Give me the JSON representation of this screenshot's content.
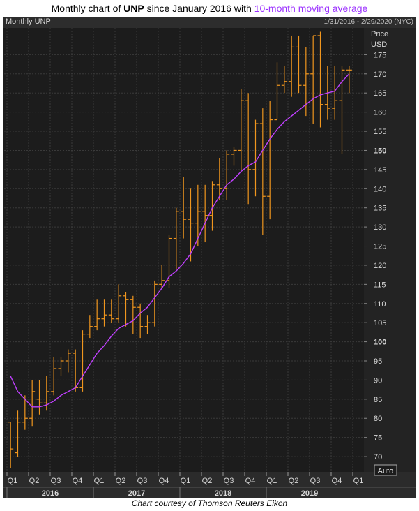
{
  "figure": {
    "title_prefix": "Monthly chart of ",
    "title_symbol": "UNP",
    "title_mid": " since January 2016 with ",
    "title_ma": "10-month moving average",
    "panel_label": "Monthly UNP",
    "date_range": "1/31/2016 - 2/29/2020 (NYC)",
    "price_label_1": "Price",
    "price_label_2": "USD",
    "auto_label": "Auto",
    "footer": "Chart courtesy of Thomson Reuters Eikon"
  },
  "colors": {
    "panel_bg": "#1c1c1c",
    "grid": "#3a3a3a",
    "bars": "#f0961e",
    "moving_average": "#c040ff",
    "axis_text": "#d8d8d8"
  },
  "chart_data": {
    "type": "ohlc",
    "title": "Monthly chart of UNP since January 2016 with 10-month moving average",
    "ylabel": "Price USD",
    "ylim": [
      66,
      182
    ],
    "y_ticks": [
      70,
      75,
      80,
      85,
      90,
      95,
      100,
      105,
      110,
      115,
      120,
      125,
      130,
      135,
      140,
      145,
      150,
      155,
      160,
      165,
      170,
      175
    ],
    "y_ticks_bold": [
      100,
      150
    ],
    "x_ticks": [
      "Q1",
      "Q2",
      "Q3",
      "Q4",
      "Q1",
      "Q2",
      "Q3",
      "Q4",
      "Q1",
      "Q2",
      "Q3",
      "Q4",
      "Q1",
      "Q2",
      "Q3",
      "Q4",
      "Q1"
    ],
    "years": [
      "2016",
      "2017",
      "2018",
      "2019"
    ],
    "grid": true,
    "months": [
      "2016-01",
      "2016-02",
      "2016-03",
      "2016-04",
      "2016-05",
      "2016-06",
      "2016-07",
      "2016-08",
      "2016-09",
      "2016-10",
      "2016-11",
      "2016-12",
      "2017-01",
      "2017-02",
      "2017-03",
      "2017-04",
      "2017-05",
      "2017-06",
      "2017-07",
      "2017-08",
      "2017-09",
      "2017-10",
      "2017-11",
      "2017-12",
      "2018-01",
      "2018-02",
      "2018-03",
      "2018-04",
      "2018-05",
      "2018-06",
      "2018-07",
      "2018-08",
      "2018-09",
      "2018-10",
      "2018-11",
      "2018-12",
      "2019-01",
      "2019-02",
      "2019-03",
      "2019-04",
      "2019-05",
      "2019-06",
      "2019-07",
      "2019-08",
      "2019-09",
      "2019-10",
      "2019-11",
      "2019-12"
    ],
    "series": [
      {
        "name": "UNP",
        "ohlc": [
          [
            79,
            79,
            67,
            72
          ],
          [
            71,
            82,
            70,
            79
          ],
          [
            79,
            86,
            77,
            80
          ],
          [
            80,
            90,
            78,
            87
          ],
          [
            85,
            90,
            81,
            84
          ],
          [
            84,
            91,
            82,
            87
          ],
          [
            87,
            96,
            86,
            93
          ],
          [
            93,
            96,
            91,
            95
          ],
          [
            95,
            98,
            92,
            97
          ],
          [
            97,
            98,
            87,
            88
          ],
          [
            88,
            103,
            87,
            102
          ],
          [
            102,
            107,
            101,
            104
          ],
          [
            104,
            111,
            103,
            106
          ],
          [
            106,
            111,
            104,
            107
          ],
          [
            107,
            111,
            105,
            106
          ],
          [
            106,
            115,
            105,
            112
          ],
          [
            112,
            113,
            104,
            111
          ],
          [
            111,
            112,
            102,
            109
          ],
          [
            109,
            110,
            101,
            104
          ],
          [
            104,
            107,
            102,
            105
          ],
          [
            105,
            116,
            104,
            115
          ],
          [
            115,
            120,
            114,
            116
          ],
          [
            116,
            128,
            114,
            127
          ],
          [
            127,
            135,
            119,
            134
          ],
          [
            134,
            143,
            127,
            132
          ],
          [
            132,
            140,
            121,
            131
          ],
          [
            131,
            141,
            125,
            134
          ],
          [
            134,
            141,
            126,
            133
          ],
          [
            133,
            142,
            129,
            141
          ],
          [
            141,
            148,
            137,
            140
          ],
          [
            140,
            150,
            137,
            149
          ],
          [
            149,
            151,
            146,
            150
          ],
          [
            150,
            166,
            145,
            163
          ],
          [
            163,
            165,
            136,
            145
          ],
          [
            145,
            158,
            138,
            157
          ],
          [
            157,
            161,
            128,
            138
          ],
          [
            138,
            163,
            132,
            158
          ],
          [
            158,
            173,
            158,
            167
          ],
          [
            167,
            172,
            165,
            168
          ],
          [
            168,
            180,
            164,
            177
          ],
          [
            177,
            180,
            165,
            167
          ],
          [
            167,
            177,
            159,
            170
          ],
          [
            170,
            180,
            157,
            180
          ],
          [
            180,
            181,
            156,
            162
          ],
          [
            162,
            172,
            158,
            161
          ],
          [
            161,
            172,
            158,
            163
          ],
          [
            163,
            172,
            149,
            171
          ],
          [
            171,
            172,
            165,
            171
          ]
        ]
      },
      {
        "name": "10-month moving average",
        "values": [
          91,
          87,
          85,
          83,
          83,
          83.5,
          84.5,
          86,
          87,
          88,
          91,
          94,
          97,
          99,
          101.5,
          103.5,
          104.5,
          105.5,
          107.5,
          109,
          111.5,
          114,
          117,
          118.5,
          120.5,
          123,
          127,
          131,
          135,
          138,
          141,
          142.5,
          144.5,
          146,
          147,
          150,
          153,
          155.5,
          157.5,
          159,
          160.5,
          162,
          163.5,
          164.5,
          165,
          165.5,
          168,
          170
        ]
      }
    ]
  }
}
